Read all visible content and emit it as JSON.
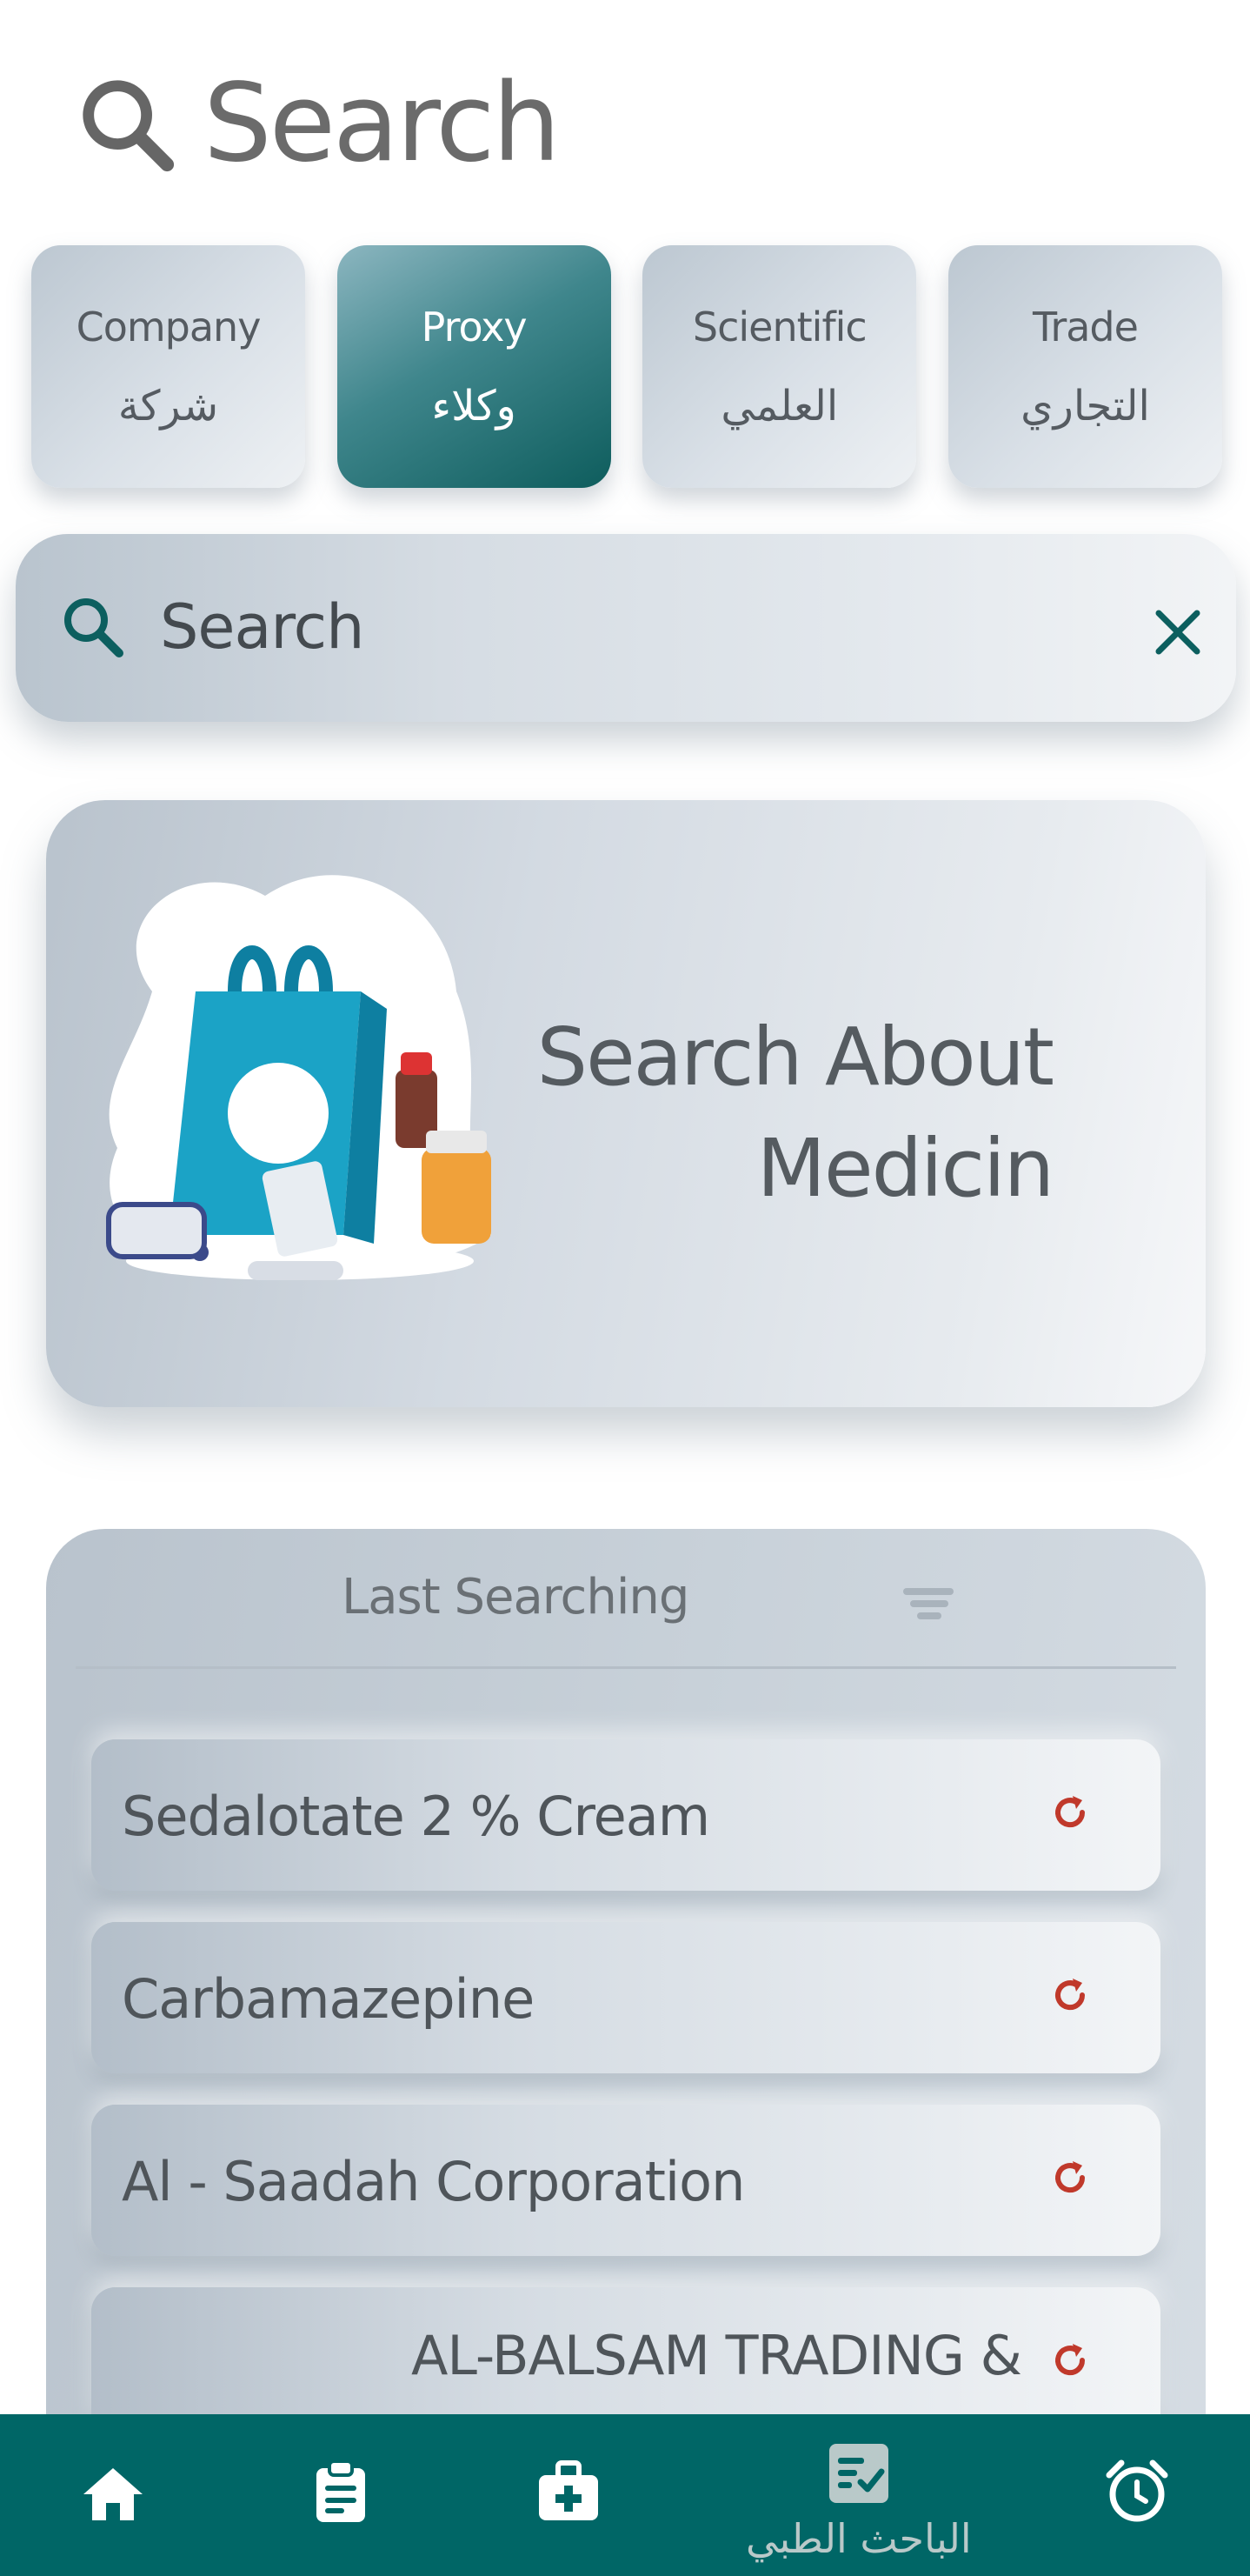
{
  "header": {
    "title": "Search",
    "icon": "search-icon"
  },
  "tabs": [
    {
      "en": "Company",
      "ar": "شركة",
      "active": false
    },
    {
      "en": "Proxy",
      "ar": "وكلاء",
      "active": true
    },
    {
      "en": "Scientific",
      "ar": "العلمي",
      "active": false
    },
    {
      "en": "Trade",
      "ar": "التجاري",
      "active": false
    }
  ],
  "search": {
    "placeholder": "Search",
    "icon": "search-icon",
    "clear_icon": "close-icon"
  },
  "banner": {
    "line1": "Search About",
    "line2": "Medicin"
  },
  "recent": {
    "title": "Last Searching",
    "sort_icon": "sort-lines-icon",
    "items": [
      {
        "label": "Sedalotate 2 % Cream"
      },
      {
        "label": "Carbamazepine"
      },
      {
        "label": "Al - Saadah Corporation"
      },
      {
        "label": "AL-BALSAM TRADING &"
      }
    ]
  },
  "nav": {
    "items": [
      {
        "icon": "home-icon"
      },
      {
        "icon": "clipboard-icon"
      },
      {
        "icon": "medical-kit-icon"
      },
      {
        "icon": "checklist-icon",
        "label": "الباحث الطبي"
      },
      {
        "icon": "alarm-clock-icon"
      }
    ]
  },
  "colors": {
    "accent": "#006666",
    "refresh": "#c0392b",
    "text": "#555b61"
  }
}
